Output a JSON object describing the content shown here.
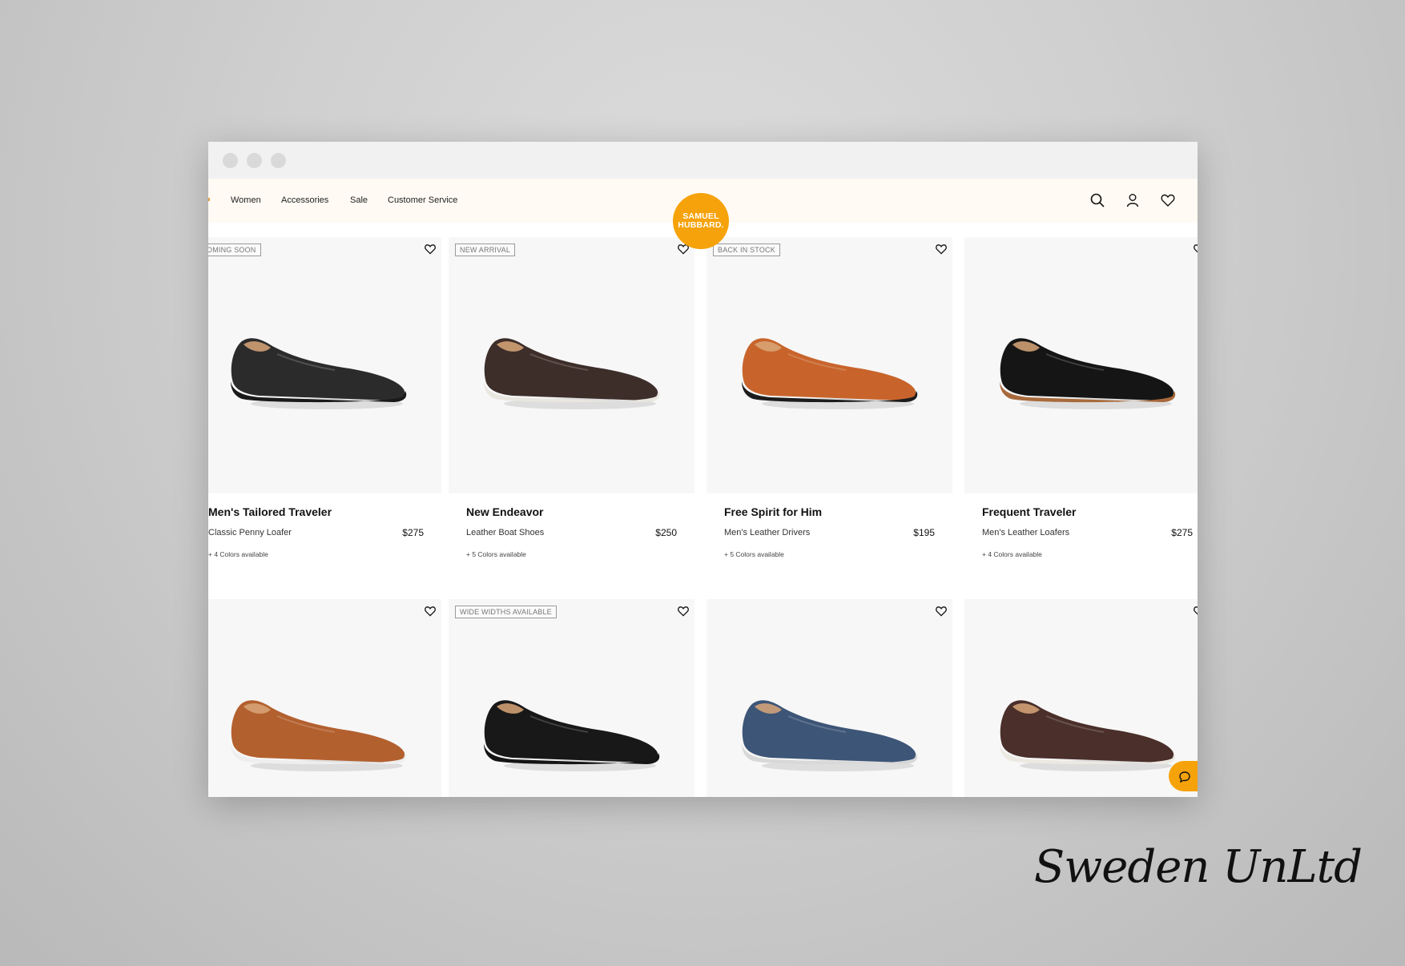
{
  "nav": {
    "items": [
      "Women",
      "Accessories",
      "Sale",
      "Customer Service"
    ]
  },
  "logo": {
    "line1": "SAMUEL",
    "line2": "HUBBARD."
  },
  "icons": {
    "search": "search-icon",
    "account": "user-icon",
    "wishlist": "heart-icon",
    "chat": "chat-bubble-icon"
  },
  "colors": {
    "accent": "#f6a20a",
    "navbar_bg": "#fffaf3",
    "card_bg": "#f7f7f7"
  },
  "products": [
    {
      "badge": "OMING SOON",
      "name": "Men's Tailored Traveler",
      "subtitle": "Classic Penny Loafer",
      "price": "$275",
      "colors": "+ 4 Colors available",
      "shoe_color": "#2b2b2b",
      "sole_color": "#1a1a1a"
    },
    {
      "badge": "NEW ARRIVAL",
      "name": "New Endeavor",
      "subtitle": "Leather Boat Shoes",
      "price": "$250",
      "colors": "+ 5 Colors available",
      "shoe_color": "#3d2e2a",
      "sole_color": "#e9e6e0"
    },
    {
      "badge": "BACK IN STOCK",
      "name": "Free Spirit for Him",
      "subtitle": "Men's Leather Drivers",
      "price": "$195",
      "colors": "+ 5 Colors available",
      "shoe_color": "#c8642b",
      "sole_color": "#1c1c1c"
    },
    {
      "badge": "",
      "name": "Frequent Traveler",
      "subtitle": "Men's Leather Loafers",
      "price": "$275",
      "colors": "+ 4 Colors available",
      "shoe_color": "#151515",
      "sole_color": "#a86a3c"
    },
    {
      "badge": "",
      "shoe_color": "#b3602f",
      "sole_color": "#eeeeee"
    },
    {
      "badge": "WIDE WIDTHS AVAILABLE",
      "shoe_color": "#181818",
      "sole_color": "#141414"
    },
    {
      "badge": "",
      "shoe_color": "#3d5577",
      "sole_color": "#d8d8d8"
    },
    {
      "badge": "",
      "shoe_color": "#4a2f2a",
      "sole_color": "#ece8e2"
    }
  ],
  "signature": "Sweden UnLtd"
}
